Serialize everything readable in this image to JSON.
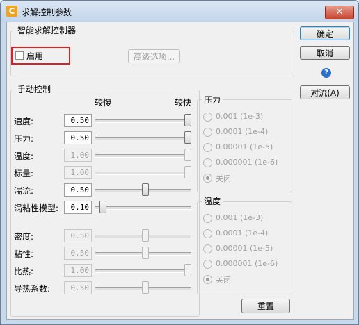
{
  "window": {
    "title": "求解控制参数",
    "close_label": "✕",
    "app_icon_glyph": "C"
  },
  "smart": {
    "group_title": "智能求解控制器",
    "enable_label": "启用",
    "enable_checked": false,
    "advanced_button": "高级选项..."
  },
  "buttons": {
    "ok": "确定",
    "cancel": "取消",
    "convection": "对流(A)",
    "reset": "重置"
  },
  "manual": {
    "group_title": "手动控制",
    "slow_label": "较慢",
    "fast_label": "较快",
    "rows": [
      {
        "label": "速度:",
        "value": "0.50",
        "enabled": true,
        "level": 1.0
      },
      {
        "label": "压力:",
        "value": "0.50",
        "enabled": true,
        "level": 1.0
      },
      {
        "label": "温度:",
        "value": "1.00",
        "enabled": false,
        "level": 1.0
      },
      {
        "label": "标量:",
        "value": "1.00",
        "enabled": false,
        "level": 1.0
      },
      {
        "label": "湍流:",
        "value": "0.50",
        "enabled": true,
        "level": 0.52
      },
      {
        "label": "涡粘性模型:",
        "value": "0.10",
        "enabled": true,
        "level": 0.05
      },
      {
        "label": "密度:",
        "value": "0.50",
        "enabled": false,
        "level": 0.52
      },
      {
        "label": "粘性:",
        "value": "0.50",
        "enabled": false,
        "level": 0.52
      },
      {
        "label": "比热:",
        "value": "1.00",
        "enabled": false,
        "level": 1.0
      },
      {
        "label": "导热系数:",
        "value": "0.50",
        "enabled": false,
        "level": 0.52
      }
    ]
  },
  "pressure": {
    "group_title": "压力",
    "options": [
      {
        "label": "0.001  (1e-3)",
        "selected": false
      },
      {
        "label": "0.0001  (1e-4)",
        "selected": false
      },
      {
        "label": "0.00001  (1e-5)",
        "selected": false
      },
      {
        "label": "0.000001  (1e-6)",
        "selected": false
      },
      {
        "label": "关闭",
        "selected": true
      }
    ]
  },
  "temperature": {
    "group_title": "温度",
    "options": [
      {
        "label": "0.001  (1e-3)",
        "selected": false
      },
      {
        "label": "0.0001  (1e-4)",
        "selected": false
      },
      {
        "label": "0.00001  (1e-5)",
        "selected": false
      },
      {
        "label": "0.000001  (1e-6)",
        "selected": false
      },
      {
        "label": "关闭",
        "selected": true
      }
    ]
  }
}
